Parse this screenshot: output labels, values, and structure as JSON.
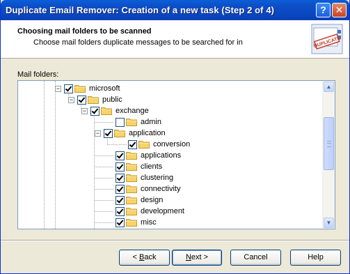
{
  "window": {
    "title": "Duplicate Email Remover: Creation of a new task (Step 2 of 4)"
  },
  "titlebar_buttons": {
    "help": "?",
    "close": "✕"
  },
  "header": {
    "title": "Choosing mail folders to be scanned",
    "subtitle": "Choose mail folders duplicate messages to be searched for in",
    "logo_text": "DUPLICATE"
  },
  "tree": {
    "label": "Mail folders:",
    "items": [
      {
        "label": "microsoft",
        "checked": true,
        "expander": "−"
      },
      {
        "label": "public",
        "checked": true,
        "expander": "−"
      },
      {
        "label": "exchange",
        "checked": true,
        "expander": "−"
      },
      {
        "label": "admin",
        "checked": false,
        "expander": ""
      },
      {
        "label": "application",
        "checked": true,
        "expander": "−"
      },
      {
        "label": "conversion",
        "checked": true,
        "expander": ""
      },
      {
        "label": "applications",
        "checked": true,
        "expander": ""
      },
      {
        "label": "clients",
        "checked": true,
        "expander": ""
      },
      {
        "label": "clustering",
        "checked": true,
        "expander": ""
      },
      {
        "label": "connectivity",
        "checked": true,
        "expander": ""
      },
      {
        "label": "design",
        "checked": true,
        "expander": ""
      },
      {
        "label": "development",
        "checked": true,
        "expander": ""
      },
      {
        "label": "misc",
        "checked": true,
        "expander": ""
      }
    ]
  },
  "buttons": {
    "back_prefix": "< ",
    "back_key": "B",
    "back_rest": "ack",
    "next_key": "N",
    "next_rest": "ext >",
    "cancel": "Cancel",
    "help": "Help"
  },
  "colors": {
    "titlebar": "#0b4fc7",
    "folder": "#f7d36b",
    "border": "#7f9db9"
  }
}
